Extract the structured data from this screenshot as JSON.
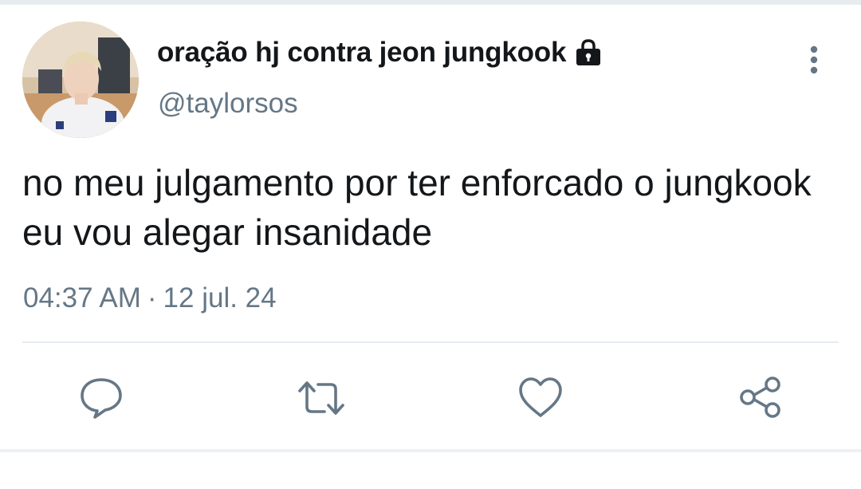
{
  "tweet": {
    "display_name": "oração hj contra jeon jungkook",
    "handle": "@taylorsos",
    "text": "no meu julgamento por ter enforcado o jungkook eu vou alegar insanidade",
    "time": "04:37 AM",
    "separator": "·",
    "date": "12 jul. 24",
    "protected_icon": "lock-icon",
    "more_icon": "more-vertical-icon"
  },
  "actions": [
    {
      "name": "reply",
      "icon": "comment-icon"
    },
    {
      "name": "retweet",
      "icon": "retweet-icon"
    },
    {
      "name": "like",
      "icon": "heart-icon"
    },
    {
      "name": "share",
      "icon": "share-icon"
    }
  ],
  "colors": {
    "text_primary": "#14171a",
    "text_secondary": "#657786",
    "icon": "#657786",
    "divider": "#e6ecf0"
  }
}
